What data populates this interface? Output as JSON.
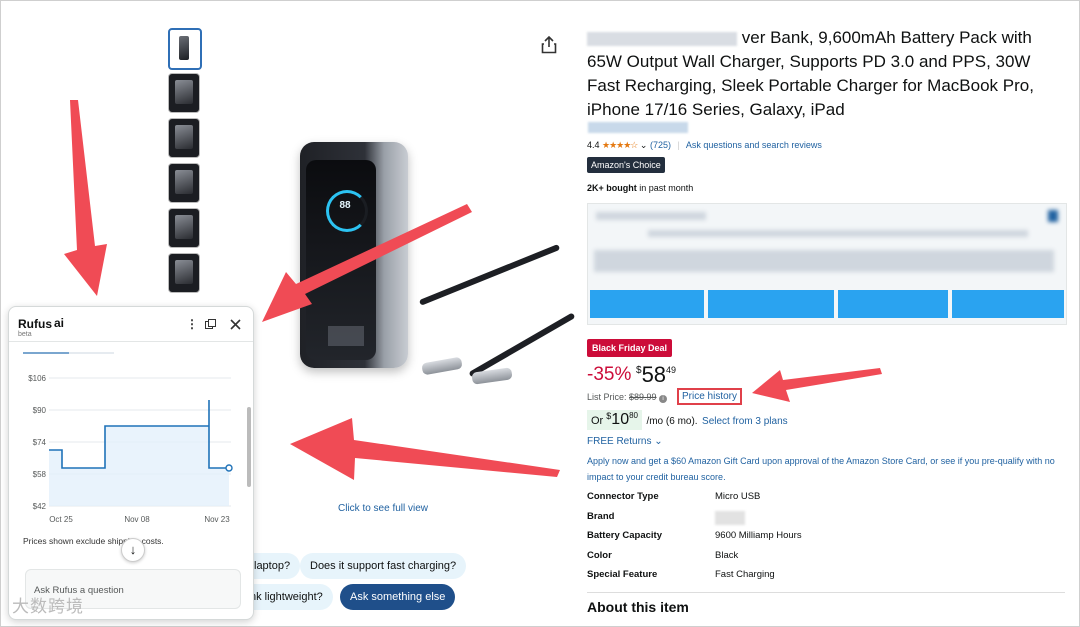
{
  "product": {
    "title_visible": "ver Bank, 9,600mAh Battery Pack with 65W Output Wall Charger, Supports PD 3.0 and PPS, 30W Fast Recharging, Sleek Portable Charger for MacBook Pro, iPhone 17/16 Series, Galaxy, iPad",
    "rating_value": "4.4",
    "rating_count": "(725)",
    "ask_reviews_link": "Ask questions and search reviews",
    "choice_badge": "Amazon's Choice",
    "bought_bold": "2K+ bought",
    "bought_rest": " in past month",
    "image_display": "88",
    "full_view_link": "Click to see full view"
  },
  "pricing": {
    "deal_badge": "Black Friday Deal",
    "discount": "-35%",
    "currency": "$",
    "price_whole": "58",
    "price_fraction": "49",
    "list_price_label": "List Price:",
    "list_price": "$89.99",
    "price_history_link": "Price history",
    "monthly_prefix": "Or ",
    "monthly_currency": "$",
    "monthly_whole": "10",
    "monthly_fraction": "80",
    "monthly_suffix": "/mo (6 mo).",
    "monthly_link": "Select from 3 plans",
    "returns": "FREE Returns",
    "gift_card_offer": "Apply now and get a $60 Amazon Gift Card upon approval of the Amazon Store Card, or see if you pre-qualify with no impact to your credit bureau score."
  },
  "specs": [
    {
      "key": "Connector Type",
      "value": "Micro USB"
    },
    {
      "key": "Brand",
      "value": ""
    },
    {
      "key": "Battery Capacity",
      "value": "9600 Milliamp Hours"
    },
    {
      "key": "Color",
      "value": "Black"
    },
    {
      "key": "Special Feature",
      "value": "Fast Charging"
    }
  ],
  "about_heading": "About this item",
  "rufus": {
    "title": "Rufus",
    "ai_mark": "ai",
    "beta": "beta",
    "note": "Prices shown exclude shipping costs.",
    "input_placeholder": "Ask Rufus a question",
    "icons": {
      "more": "more-vertical-icon",
      "expand": "popout-icon",
      "close": "close-icon",
      "scroll_down": "arrow-down-icon"
    }
  },
  "chips": {
    "laptop": "laptop?",
    "fast_charging": "Does it support fast charging?",
    "lightweight": "nk lightweight?",
    "ask_else": "Ask something else"
  },
  "chart_data": {
    "type": "line",
    "title": "",
    "xlabel": "",
    "ylabel": "",
    "x_ticks": [
      "Oct 25",
      "Nov 08",
      "Nov 23"
    ],
    "y_ticks": [
      "$42",
      "$58",
      "$74",
      "$90",
      "$106"
    ],
    "ylim": [
      42,
      106
    ],
    "grid": true,
    "x": [
      "Oct 24",
      "Oct 25",
      "Oct 30",
      "Nov 03",
      "Nov 21",
      "Nov 22",
      "Nov 23",
      "Nov 24"
    ],
    "series": [
      {
        "values": [
          70,
          61,
          61,
          82,
          82,
          95,
          61,
          61
        ]
      }
    ],
    "color": "#1f72b8"
  },
  "watermark": "大数跨境",
  "colors": {
    "link": "#2162a1",
    "deal": "#cc0c39",
    "arrow": "#f04b55"
  }
}
